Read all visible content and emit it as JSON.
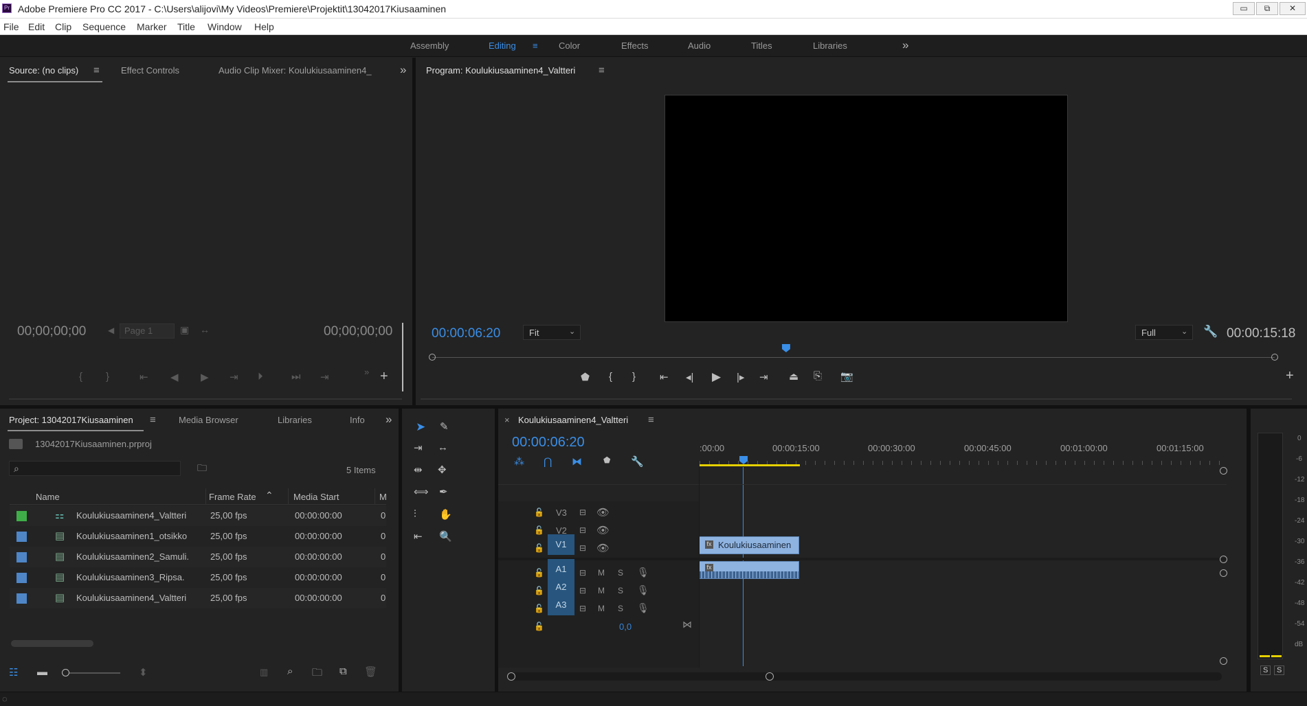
{
  "window": {
    "title": "Adobe Premiere Pro CC 2017 - C:\\Users\\alijovi\\My Videos\\Premiere\\Projektit\\13042017Kiusaaminen",
    "app_icon": "Pr",
    "minimize": "▭",
    "restore": "⧉",
    "close": "✕"
  },
  "menu": [
    "File",
    "Edit",
    "Clip",
    "Sequence",
    "Marker",
    "Title",
    "Window",
    "Help"
  ],
  "workspaces": {
    "items": [
      "Assembly",
      "Editing",
      "Color",
      "Effects",
      "Audio",
      "Titles",
      "Libraries"
    ],
    "active": "Editing",
    "more": "»"
  },
  "source_panel": {
    "tabs": [
      "Source: (no clips)",
      "Effect Controls",
      "Audio Clip Mixer: Koulukiusaaminen4_"
    ],
    "timecode_in": "00;00;00;00",
    "timecode_out": "00;00;00;00",
    "page_label": "Page 1",
    "more": "»",
    "add": "+"
  },
  "program_panel": {
    "title": "Program: Koulukiusaaminen4_Valtteri",
    "timecode": "00:00:06:20",
    "fit": "Fit",
    "resolution": "Full",
    "duration": "00:00:15:18",
    "playhead_fraction": 0.42,
    "add": "+"
  },
  "project_panel": {
    "tabs": [
      "Project: 13042017Kiusaaminen",
      "Media Browser",
      "Libraries",
      "Info"
    ],
    "file": "13042017Kiusaaminen.prproj",
    "search_placeholder": "",
    "item_count": "5 Items",
    "columns": [
      "Name",
      "Frame Rate",
      "Media Start",
      "M"
    ],
    "rows": [
      {
        "name": "Koulukiusaaminen4_Valtteri",
        "fps": "25,00 fps",
        "start": "00:00:00:00",
        "m": "0",
        "color": "#3fae49",
        "icon": "sequence-icon"
      },
      {
        "name": "Koulukiusaaminen1_otsikko",
        "fps": "25,00 fps",
        "start": "00:00:00:00",
        "m": "0",
        "color": "#4e86c8",
        "icon": "media-icon"
      },
      {
        "name": "Koulukiusaaminen2_Samuli.",
        "fps": "25,00 fps",
        "start": "00:00:00:00",
        "m": "0",
        "color": "#4e86c8",
        "icon": "media-icon"
      },
      {
        "name": "Koulukiusaaminen3_Ripsa.",
        "fps": "25,00 fps",
        "start": "00:00:00:00",
        "m": "0",
        "color": "#4e86c8",
        "icon": "media-icon"
      },
      {
        "name": "Koulukiusaaminen4_Valtteri",
        "fps": "25,00 fps",
        "start": "00:00:00:00",
        "m": "0",
        "color": "#4e86c8",
        "icon": "media-icon"
      }
    ]
  },
  "timeline": {
    "close": "×",
    "sequence_name": "Koulukiusaaminen4_Valtteri",
    "timecode": "00:00:06:20",
    "ruler": [
      ":00:00",
      "00:00:15:00",
      "00:00:30:00",
      "00:00:45:00",
      "00:01:00:00",
      "00:01:15:00"
    ],
    "video_tracks": [
      "V3",
      "V2",
      "V1"
    ],
    "audio_tracks": [
      "A1",
      "A2",
      "A3"
    ],
    "mute_label": "M",
    "solo_label": "S",
    "master_value": "0,0",
    "clip_label": "Koulukiusaaminen"
  },
  "audio_meter": {
    "labels": [
      "0",
      "-6",
      "-12",
      "-18",
      "-24",
      "-30",
      "-36",
      "-42",
      "-48",
      "-54",
      "dB"
    ],
    "solo_left": "S",
    "solo_right": "S"
  },
  "colors": {
    "accent": "#3a8ee6",
    "track_active": "#2a5b86",
    "clip": "#8fb3e0"
  }
}
